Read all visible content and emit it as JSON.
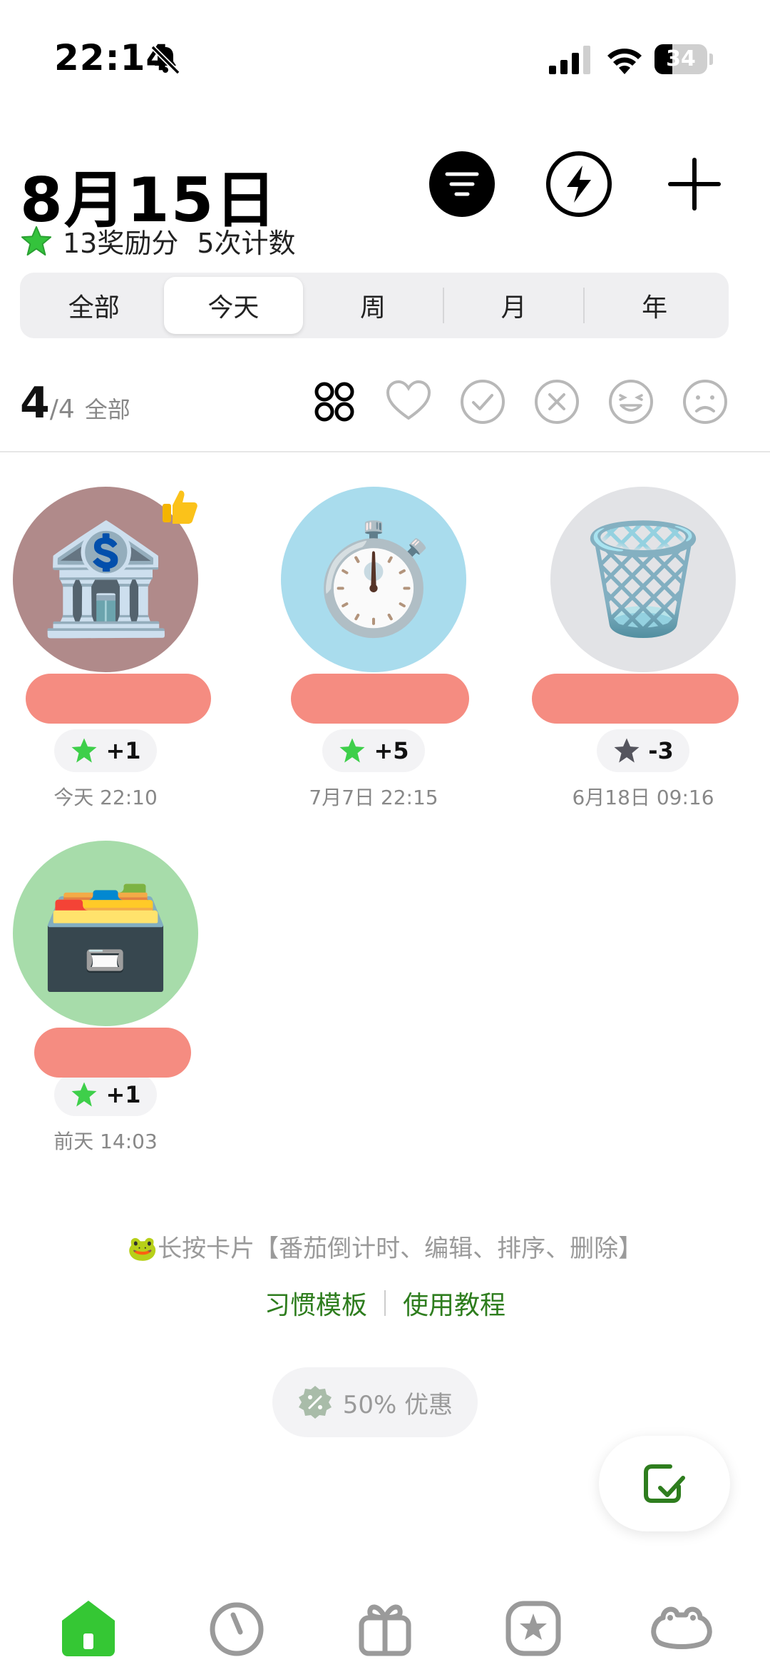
{
  "status_bar": {
    "time": "22:14",
    "battery": "34",
    "battery_level": 0.34
  },
  "header": {
    "date": "8月15日",
    "reward_points": "13奖励分",
    "count_times": "5次计数"
  },
  "segments": [
    {
      "label": "全部",
      "active": false
    },
    {
      "label": "今天",
      "active": true
    },
    {
      "label": "周",
      "active": false
    },
    {
      "label": "月",
      "active": false
    },
    {
      "label": "年",
      "active": false
    }
  ],
  "count_row": {
    "done": "4",
    "total": "/4",
    "label": "全部"
  },
  "habits": [
    {
      "emoji": "🏦",
      "points": "+1",
      "time": "今天 22:10",
      "bg": "#b08a8a",
      "star_color": "#3ecf4a",
      "liked": true
    },
    {
      "emoji": "⏱️",
      "points": "+5",
      "time": "7月7日 22:15",
      "bg": "#a9dced",
      "star_color": "#3ecf4a",
      "liked": false
    },
    {
      "emoji": "🗑️",
      "points": "-3",
      "time": "6月18日 09:16",
      "bg": "#e2e3e6",
      "star_color": "#55555e",
      "liked": false
    },
    {
      "emoji": "🗃️",
      "points": "+1",
      "time": "前天 14:03",
      "bg": "#a7dcaa",
      "star_color": "#3ecf4a",
      "liked": false
    }
  ],
  "tip": {
    "icon": "🐸",
    "text": "长按卡片【番茄倒计时、编辑、排序、删除】"
  },
  "links": {
    "templates": "习惯模板",
    "tutorial": "使用教程"
  },
  "promo": {
    "text": "50% 优惠"
  },
  "colors": {
    "accent_green": "#2e7d1e",
    "tab_active": "#35c734",
    "tab_inactive": "#9a9a9a"
  }
}
